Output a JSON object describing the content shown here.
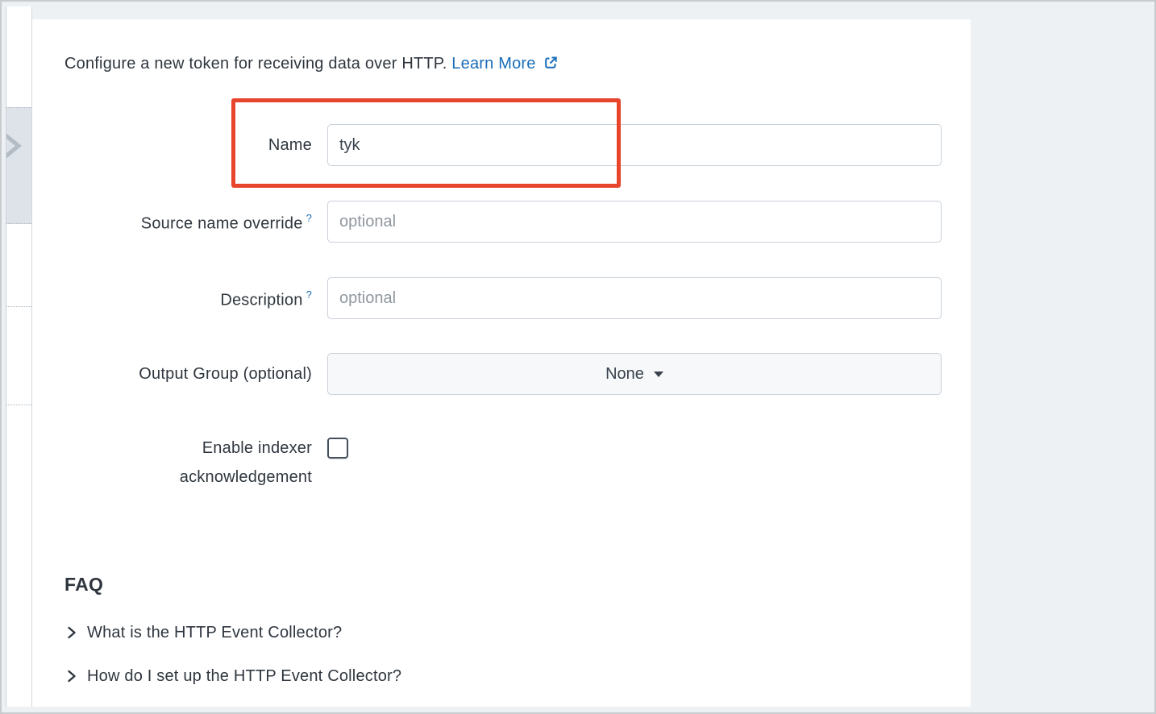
{
  "header": {
    "intro_text": "Configure a new token for receiving data over HTTP.",
    "learn_more": "Learn More"
  },
  "form": {
    "name": {
      "label": "Name",
      "value": "tyk"
    },
    "source_name_override": {
      "label": "Source name override",
      "help_indicator": "?",
      "placeholder": "optional"
    },
    "description": {
      "label": "Description",
      "help_indicator": "?",
      "placeholder": "optional"
    },
    "output_group": {
      "label": "Output Group (optional)",
      "selected_value": "None"
    },
    "indexer_acknowledgement": {
      "label": "Enable indexer acknowledgement",
      "checked": false
    }
  },
  "faq": {
    "title": "FAQ",
    "items": [
      {
        "label": "What is the HTTP Event Collector?"
      },
      {
        "label": "How do I set up the HTTP Event Collector?"
      }
    ]
  },
  "colors": {
    "annotation_highlight": "#e8452d",
    "link_blue": "#1a6db8"
  }
}
